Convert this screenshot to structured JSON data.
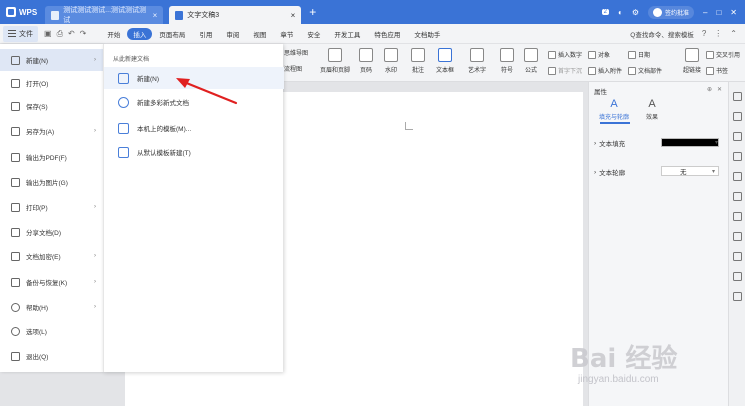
{
  "titlebar": {
    "app_name": "WPS",
    "tabs": [
      {
        "label": "测试测试测试...测试测试测试",
        "active": false
      },
      {
        "label": "文字文稿3",
        "active": true
      }
    ],
    "new_tab_symbol": "+",
    "close_symbol": "×",
    "badge_count": "2",
    "user_label": "签约批准",
    "right_icons": [
      "skin-icon",
      "settings-icon",
      "window-icon",
      "minimize-icon",
      "maximize-icon",
      "close-icon"
    ]
  },
  "ribbon_tabs": {
    "file_label": "文件",
    "tabs": [
      "开始",
      "插入",
      "页面布局",
      "引用",
      "审阅",
      "视图",
      "章节",
      "安全",
      "开发工具",
      "特色应用",
      "文档助手"
    ],
    "active_tab": "插入",
    "search_label": "Q查找命令、搜索模板",
    "help_symbol": "?"
  },
  "ribbon_tools": {
    "first_labels": [
      "思维导图",
      "流程图"
    ],
    "big": [
      "页眉和页脚",
      "页码",
      "水印",
      "批注",
      "文本框",
      "艺术字",
      "符号",
      "公式"
    ],
    "small": [
      "插入数字",
      "对象",
      "日期",
      "插入附件",
      "文档部件",
      "超链接",
      "书签",
      "交叉引用",
      "首字下沉"
    ]
  },
  "file_menu": {
    "items": [
      {
        "label": "新建(N)",
        "icon": "new-doc-icon",
        "has_submenu": true,
        "selected": true
      },
      {
        "label": "打开(O)",
        "icon": "folder-icon",
        "has_submenu": false
      },
      {
        "label": "保存(S)",
        "icon": "save-icon",
        "has_submenu": false
      },
      {
        "label": "另存为(A)",
        "icon": "save-as-icon",
        "has_submenu": true
      },
      {
        "label": "输出为PDF(F)",
        "icon": "pdf-icon",
        "has_submenu": false
      },
      {
        "label": "输出为图片(G)",
        "icon": "image-icon",
        "has_submenu": false
      },
      {
        "label": "打印(P)",
        "icon": "print-icon",
        "has_submenu": true
      },
      {
        "label": "分享文档(D)",
        "icon": "share-icon",
        "has_submenu": false
      },
      {
        "label": "文档加密(E)",
        "icon": "lock-icon",
        "has_submenu": true
      },
      {
        "label": "备份与恢复(K)",
        "icon": "backup-icon",
        "has_submenu": true
      },
      {
        "label": "帮助(H)",
        "icon": "help-icon",
        "has_submenu": true
      },
      {
        "label": "选项(L)",
        "icon": "gear-icon",
        "has_submenu": false
      },
      {
        "label": "退出(Q)",
        "icon": "exit-icon",
        "has_submenu": false
      }
    ],
    "arrow_symbol": "›"
  },
  "submenu": {
    "title": "从此新建文档",
    "items": [
      {
        "label": "新建(N)",
        "icon": "blank-doc-icon"
      },
      {
        "label": "新建多彩新式文档",
        "icon": "colorful-doc-icon"
      },
      {
        "label": "本机上的模板(M)...",
        "icon": "local-template-icon"
      },
      {
        "label": "从默认模板新建(T)",
        "icon": "default-template-icon"
      }
    ]
  },
  "props_panel": {
    "title": "属性",
    "tabs": [
      {
        "label": "填充与轮廓",
        "icon_glyph": "A",
        "active": true
      },
      {
        "label": "效果",
        "icon_glyph": "A",
        "active": false
      }
    ],
    "rows": [
      {
        "label": "文本填充",
        "expander": "›"
      },
      {
        "label": "文本轮廓",
        "expander": "›"
      }
    ],
    "fill_color": "#000000",
    "outline_value": "无",
    "caret_symbol": "▾"
  },
  "watermark": {
    "brand": "Bai  经验",
    "url": "jingyan.baidu.com"
  },
  "colors": {
    "titlebar_blue": "#3a73d6",
    "arrow_red": "#e02020"
  }
}
